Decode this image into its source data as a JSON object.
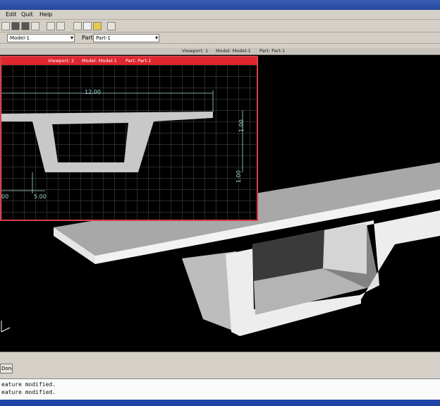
{
  "menu": [
    "Edit",
    "Quit",
    "Help"
  ],
  "context": {
    "model_value": "Model-1",
    "part_label": "Part",
    "part_value": "Part-1"
  },
  "viewport_tabs": [
    "Viewport: 1",
    "Model: Model-1",
    "Part: Part-1"
  ],
  "inset": {
    "title": [
      "Viewport: 2",
      "Model: Model-1",
      "Part: Part-1"
    ],
    "dims": {
      "width": "12.00",
      "height_a": "1.00",
      "height_b": "1.00",
      "bottom_left": "00",
      "bottom_mid": "5.00"
    }
  },
  "command": {
    "button_label": "Done"
  },
  "messages": [
    "eature modified.",
    "eature modified."
  ],
  "colors": {
    "viewport_bg": "#000000",
    "inset_border": "#d8404a",
    "dimension_text": "#9fdcd4",
    "model_face": "#ececec"
  }
}
